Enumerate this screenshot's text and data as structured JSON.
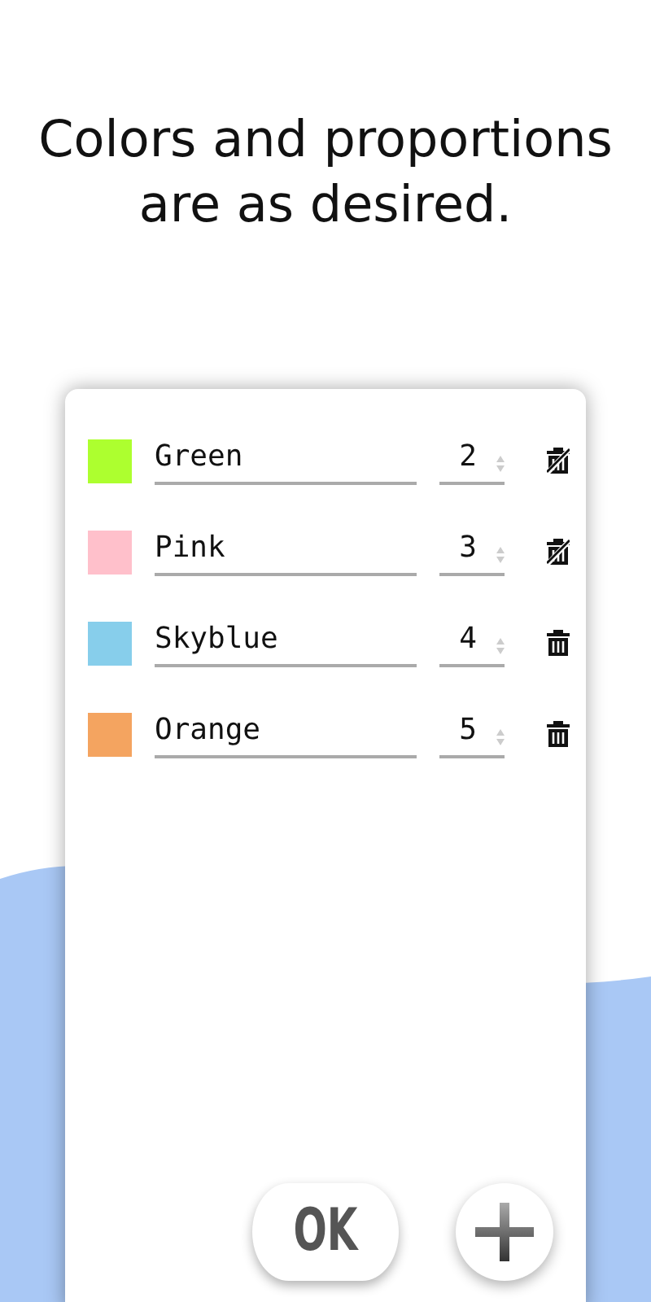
{
  "headline": "Colors and proportions are as desired.",
  "items": [
    {
      "name": "Green",
      "color": "#adff2f",
      "ratio": "2",
      "deletable": false
    },
    {
      "name": "Pink",
      "color": "#ffc0cb",
      "ratio": "3",
      "deletable": false
    },
    {
      "name": "Skyblue",
      "color": "#87ceeb",
      "ratio": "4",
      "deletable": true
    },
    {
      "name": "Orange",
      "color": "#f4a460",
      "ratio": "5",
      "deletable": true
    }
  ],
  "ok_button": "OK"
}
